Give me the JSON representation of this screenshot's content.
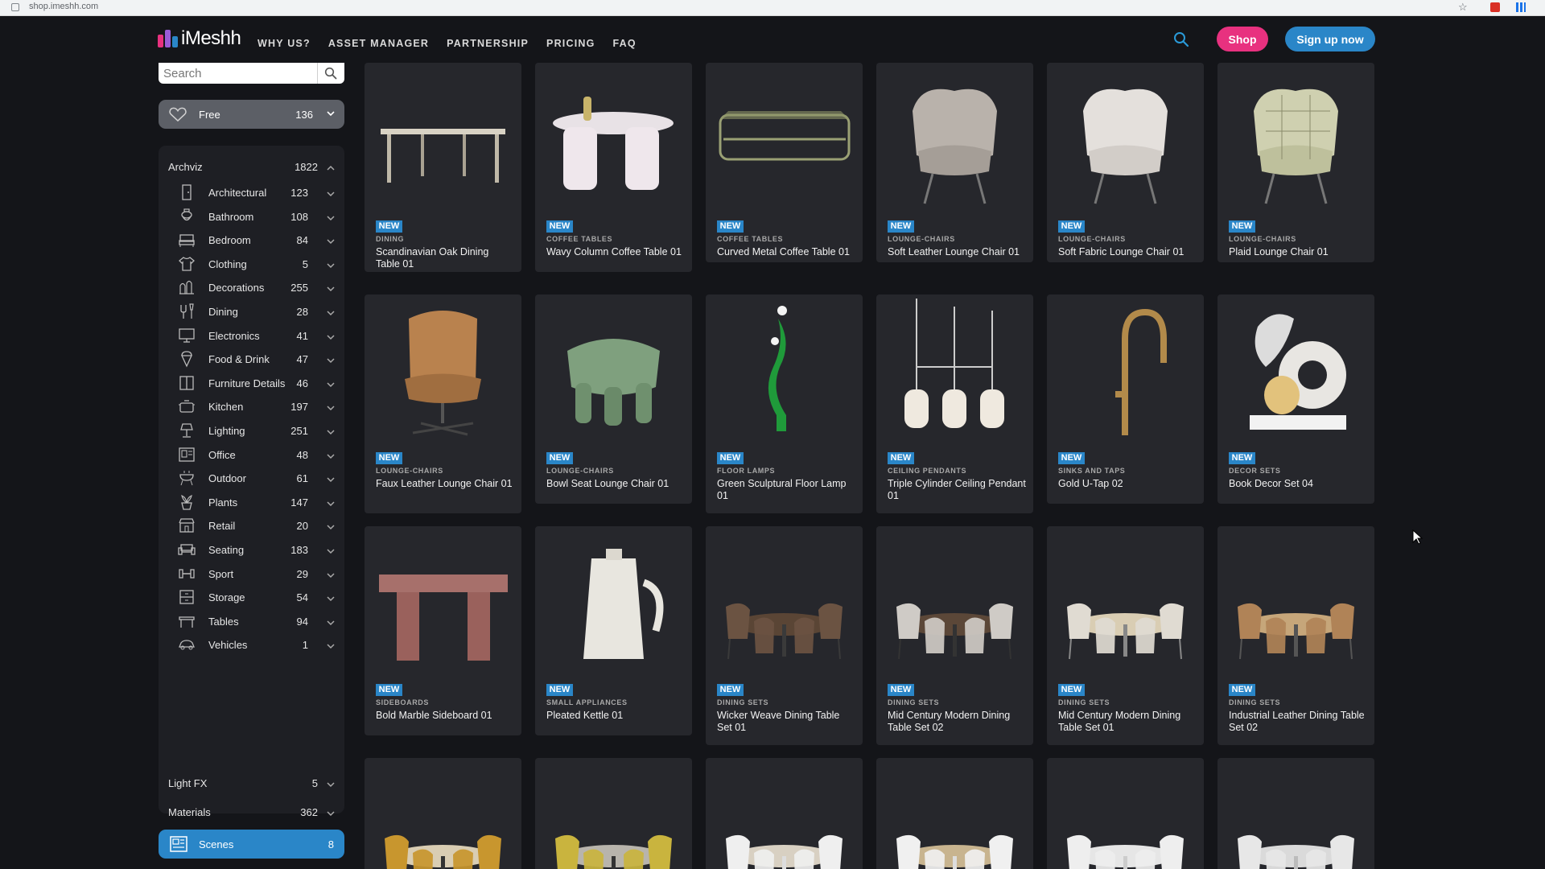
{
  "browser": {
    "url": "shop.imeshh.com"
  },
  "header": {
    "logo_text": "iMeshh",
    "nav": [
      "WHY US?",
      "ASSET MANAGER",
      "PARTNERSHIP",
      "PRICING",
      "FAQ"
    ],
    "shop_label": "Shop",
    "signup_label": "Sign up now",
    "colors": {
      "shop": "#e8317f",
      "signup": "#2a86c8"
    }
  },
  "sidebar": {
    "search_placeholder": "Search",
    "free": {
      "label": "Free",
      "count": "136"
    },
    "archviz": {
      "label": "Archviz",
      "count": "1822"
    },
    "categories": [
      {
        "label": "Architectural",
        "count": "123",
        "icon": "door-icon"
      },
      {
        "label": "Bathroom",
        "count": "108",
        "icon": "toilet-icon"
      },
      {
        "label": "Bedroom",
        "count": "84",
        "icon": "bed-icon"
      },
      {
        "label": "Clothing",
        "count": "5",
        "icon": "shirt-icon"
      },
      {
        "label": "Decorations",
        "count": "255",
        "icon": "decor-icon"
      },
      {
        "label": "Dining",
        "count": "28",
        "icon": "dining-icon"
      },
      {
        "label": "Electronics",
        "count": "41",
        "icon": "monitor-icon"
      },
      {
        "label": "Food & Drink",
        "count": "47",
        "icon": "ice-cream-icon"
      },
      {
        "label": "Furniture Details",
        "count": "46",
        "icon": "panel-icon"
      },
      {
        "label": "Kitchen",
        "count": "197",
        "icon": "pot-icon"
      },
      {
        "label": "Lighting",
        "count": "251",
        "icon": "lamp-icon"
      },
      {
        "label": "Office",
        "count": "48",
        "icon": "office-icon"
      },
      {
        "label": "Outdoor",
        "count": "61",
        "icon": "grill-icon"
      },
      {
        "label": "Plants",
        "count": "147",
        "icon": "plant-icon"
      },
      {
        "label": "Retail",
        "count": "20",
        "icon": "shop-icon"
      },
      {
        "label": "Seating",
        "count": "183",
        "icon": "sofa-icon"
      },
      {
        "label": "Sport",
        "count": "29",
        "icon": "dumbbell-icon"
      },
      {
        "label": "Storage",
        "count": "54",
        "icon": "drawer-icon"
      },
      {
        "label": "Tables",
        "count": "94",
        "icon": "table-icon"
      },
      {
        "label": "Vehicles",
        "count": "1",
        "icon": "car-icon"
      }
    ],
    "light_fx": {
      "label": "Light FX",
      "count": "5"
    },
    "materials": {
      "label": "Materials",
      "count": "362"
    },
    "scenes": {
      "label": "Scenes",
      "count": "8"
    }
  },
  "products": [
    {
      "badge": "NEW",
      "category": "DINING",
      "name": "Scandinavian Oak Dining Table 01",
      "art": "long-table"
    },
    {
      "badge": "NEW",
      "category": "COFFEE TABLES",
      "name": "Wavy Column Coffee Table 01",
      "art": "wavy-table"
    },
    {
      "badge": "NEW",
      "category": "COFFEE TABLES",
      "name": "Curved Metal Coffee Table 01",
      "art": "metal-table"
    },
    {
      "badge": "NEW",
      "category": "LOUNGE-CHAIRS",
      "name": "Soft Leather Lounge Chair 01",
      "art": "lounge-grey"
    },
    {
      "badge": "NEW",
      "category": "LOUNGE-CHAIRS",
      "name": "Soft Fabric Lounge Chair 01",
      "art": "lounge-white"
    },
    {
      "badge": "NEW",
      "category": "LOUNGE-CHAIRS",
      "name": "Plaid Lounge Chair 01",
      "art": "lounge-plaid"
    },
    {
      "badge": "NEW",
      "category": "LOUNGE-CHAIRS",
      "name": "Faux Leather Lounge Chair 01",
      "art": "lounge-tan"
    },
    {
      "badge": "NEW",
      "category": "LOUNGE-CHAIRS",
      "name": "Bowl Seat Lounge Chair 01",
      "art": "bowl-chair"
    },
    {
      "badge": "NEW",
      "category": "FLOOR LAMPS",
      "name": "Green Sculptural Floor Lamp 01",
      "art": "green-lamp"
    },
    {
      "badge": "NEW",
      "category": "CEILING PENDANTS",
      "name": "Triple Cylinder Ceiling Pendant 01",
      "art": "pendants"
    },
    {
      "badge": "NEW",
      "category": "SINKS AND TAPS",
      "name": "Gold U-Tap 02",
      "art": "tap"
    },
    {
      "badge": "NEW",
      "category": "DECOR SETS",
      "name": "Book Decor Set 04",
      "art": "decor"
    },
    {
      "badge": "NEW",
      "category": "SIDEBOARDS",
      "name": "Bold Marble Sideboard 01",
      "art": "marble"
    },
    {
      "badge": "NEW",
      "category": "SMALL APPLIANCES",
      "name": "Pleated Kettle 01",
      "art": "kettle"
    },
    {
      "badge": "NEW",
      "category": "DINING SETS",
      "name": "Wicker Weave Dining Table Set 01",
      "art": "set-wicker"
    },
    {
      "badge": "NEW",
      "category": "DINING SETS",
      "name": "Mid Century Modern Dining Table Set 02",
      "art": "set-grey"
    },
    {
      "badge": "NEW",
      "category": "DINING SETS",
      "name": "Mid Century Modern Dining Table Set 01",
      "art": "set-light"
    },
    {
      "badge": "NEW",
      "category": "DINING SETS",
      "name": "Industrial Leather Dining Table Set 02",
      "art": "set-leather"
    },
    {
      "badge": "",
      "category": "",
      "name": "",
      "art": "set-mustard"
    },
    {
      "badge": "",
      "category": "",
      "name": "",
      "art": "set-yellow"
    },
    {
      "badge": "",
      "category": "",
      "name": "",
      "art": "set-white-chairs"
    },
    {
      "badge": "",
      "category": "",
      "name": "",
      "art": "set-bench"
    },
    {
      "badge": "",
      "category": "",
      "name": "",
      "art": "set-white-round"
    },
    {
      "badge": "",
      "category": "",
      "name": "",
      "art": "set-white-oval"
    }
  ]
}
